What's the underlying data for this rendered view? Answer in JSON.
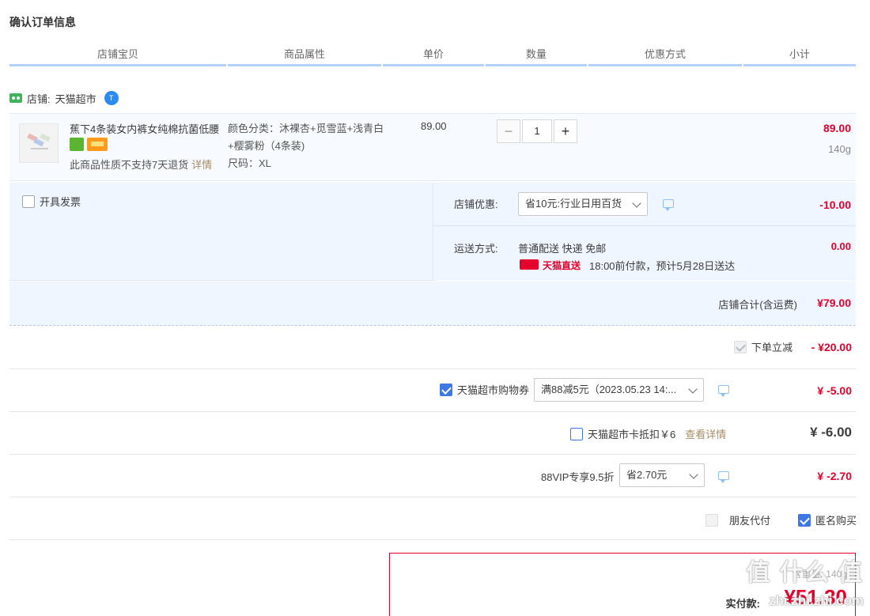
{
  "page": {
    "title": "确认订单信息"
  },
  "columns": [
    "店铺宝贝",
    "商品属性",
    "单价",
    "数量",
    "优惠方式",
    "小计"
  ],
  "shop": {
    "label": "店铺:",
    "name": "天猫超市",
    "badge": "T"
  },
  "item": {
    "name": "蕉下4条装女内裤女纯棉抗菌低腰",
    "no_return_text": "此商品性质不支持7天退货",
    "detail_link": "详情",
    "attr_color": "颜色分类：沐裸杏+觅雪蓝+浅青白+樱雾粉（4条装)",
    "attr_size": "尺码：XL",
    "unit_price": "89.00",
    "qty_minus": "−",
    "quantity": "1",
    "qty_plus": "+",
    "subtotal": "89.00",
    "weight": "140g"
  },
  "invoice_label": "开具发票",
  "shop_discount": {
    "label": "店铺优惠:",
    "selected": "省10元:行业日用百货",
    "amount": "-10.00"
  },
  "shipping": {
    "label": "运送方式:",
    "method": "普通配送 快递 免邮",
    "badge_text": "天猫直送",
    "eta": "18:00前付款，预计5月28日送达",
    "amount": "0.00"
  },
  "shop_total": {
    "label": "店铺合计(含运费)",
    "amount": "¥79.00"
  },
  "instant_discount": {
    "label": "下单立减",
    "amount": "- ¥20.00"
  },
  "voucher": {
    "label": "天猫超市购物券",
    "selected": "满88减5元（2023.05.23 14:...",
    "amount": "¥ -5.00"
  },
  "card": {
    "label": "天猫超市卡抵扣￥6",
    "link": "查看详情",
    "amount": "¥ -6.00"
  },
  "vip": {
    "label": "88VIP专享9.5折",
    "selected": "省2.70元",
    "amount": "¥ -2.70"
  },
  "friend_pay_label": "朋友代付",
  "anonymous_label": "匿名购买",
  "pay": {
    "sub": "含重量: 140g",
    "label": "实付款:",
    "amount": "¥51.30"
  },
  "watermark": {
    "logo": "值 什么 值",
    "url": "zhi.zhi.zhi.com"
  },
  "colors": {
    "accent_red": "#e4002b",
    "header_line": "#b2d1ff",
    "panel_bg": "#f0f6ff",
    "checkbox_blue": "#3e78e4",
    "gold_link": "#a88d64"
  }
}
